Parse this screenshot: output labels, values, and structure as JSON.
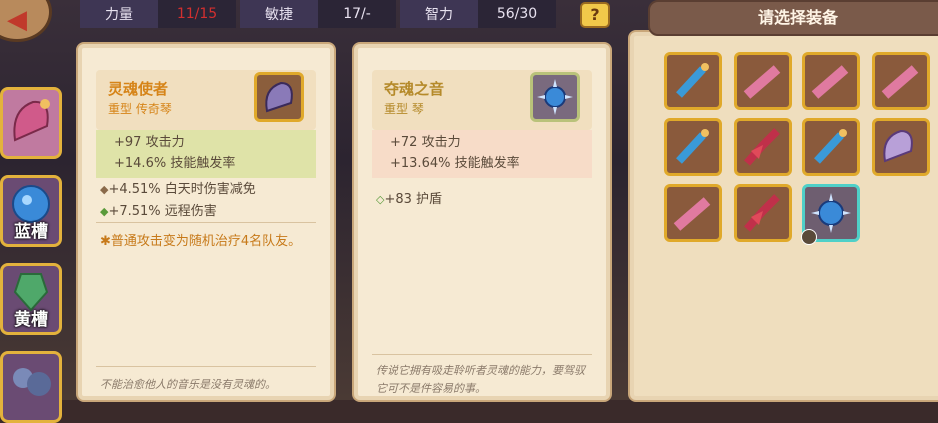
{
  "stats": [
    {
      "label": "力量",
      "value": "11/15",
      "color": "#d32f2f"
    },
    {
      "label": "敏捷",
      "value": "17/-",
      "color": "#e8e2f0"
    },
    {
      "label": "智力",
      "value": "56/30",
      "color": "#e8e2f0"
    }
  ],
  "help_label": "?",
  "left_slots": [
    {
      "label": "",
      "icon": "harp-icon"
    },
    {
      "label": "蓝槽",
      "icon": "blue-gem-icon"
    },
    {
      "label": "黄槽",
      "icon": "yellow-gem-icon"
    },
    {
      "label": "",
      "icon": "orb-icon"
    }
  ],
  "panel_left": {
    "name": "灵魂使者",
    "type": "重型 传奇琴",
    "main_stats": [
      "+97 攻击力",
      "+14.6% 技能触发率"
    ],
    "bonus_stats": [
      {
        "bullet": "◆",
        "text": "+4.51% 白天时伤害减免"
      },
      {
        "bullet": "◆",
        "text": "+7.51% 远程伤害"
      }
    ],
    "special": "✱普通攻击变为随机治疗4名队友。",
    "flavor": "不能治愈他人的音乐是没有灵魂的。"
  },
  "panel_right": {
    "name": "夺魂之音",
    "type": "重型 琴",
    "main_stats": [
      "+72 攻击力",
      "+13.64% 技能触发率"
    ],
    "bonus_stats": [
      {
        "bullet": "◇",
        "text": "+83 护盾"
      }
    ],
    "flavor": "传说它拥有吸走聆听者灵魂的能力，要驾驭它可不是件容易的事。"
  },
  "select_header": "请选择装备",
  "grid_items": [
    {
      "icon": "blue-harp-icon"
    },
    {
      "icon": "pink-keytar-icon"
    },
    {
      "icon": "pink-keytar-icon"
    },
    {
      "icon": "pink-keytar-icon"
    },
    {
      "icon": "blue-harp-icon"
    },
    {
      "icon": "red-guitar-icon"
    },
    {
      "icon": "blue-harp-icon"
    },
    {
      "icon": "purple-harp-icon"
    },
    {
      "icon": "pink-keytar-icon"
    },
    {
      "icon": "red-guitar-icon"
    },
    {
      "icon": "spiked-lute-icon",
      "selected": true,
      "locked": true
    }
  ]
}
